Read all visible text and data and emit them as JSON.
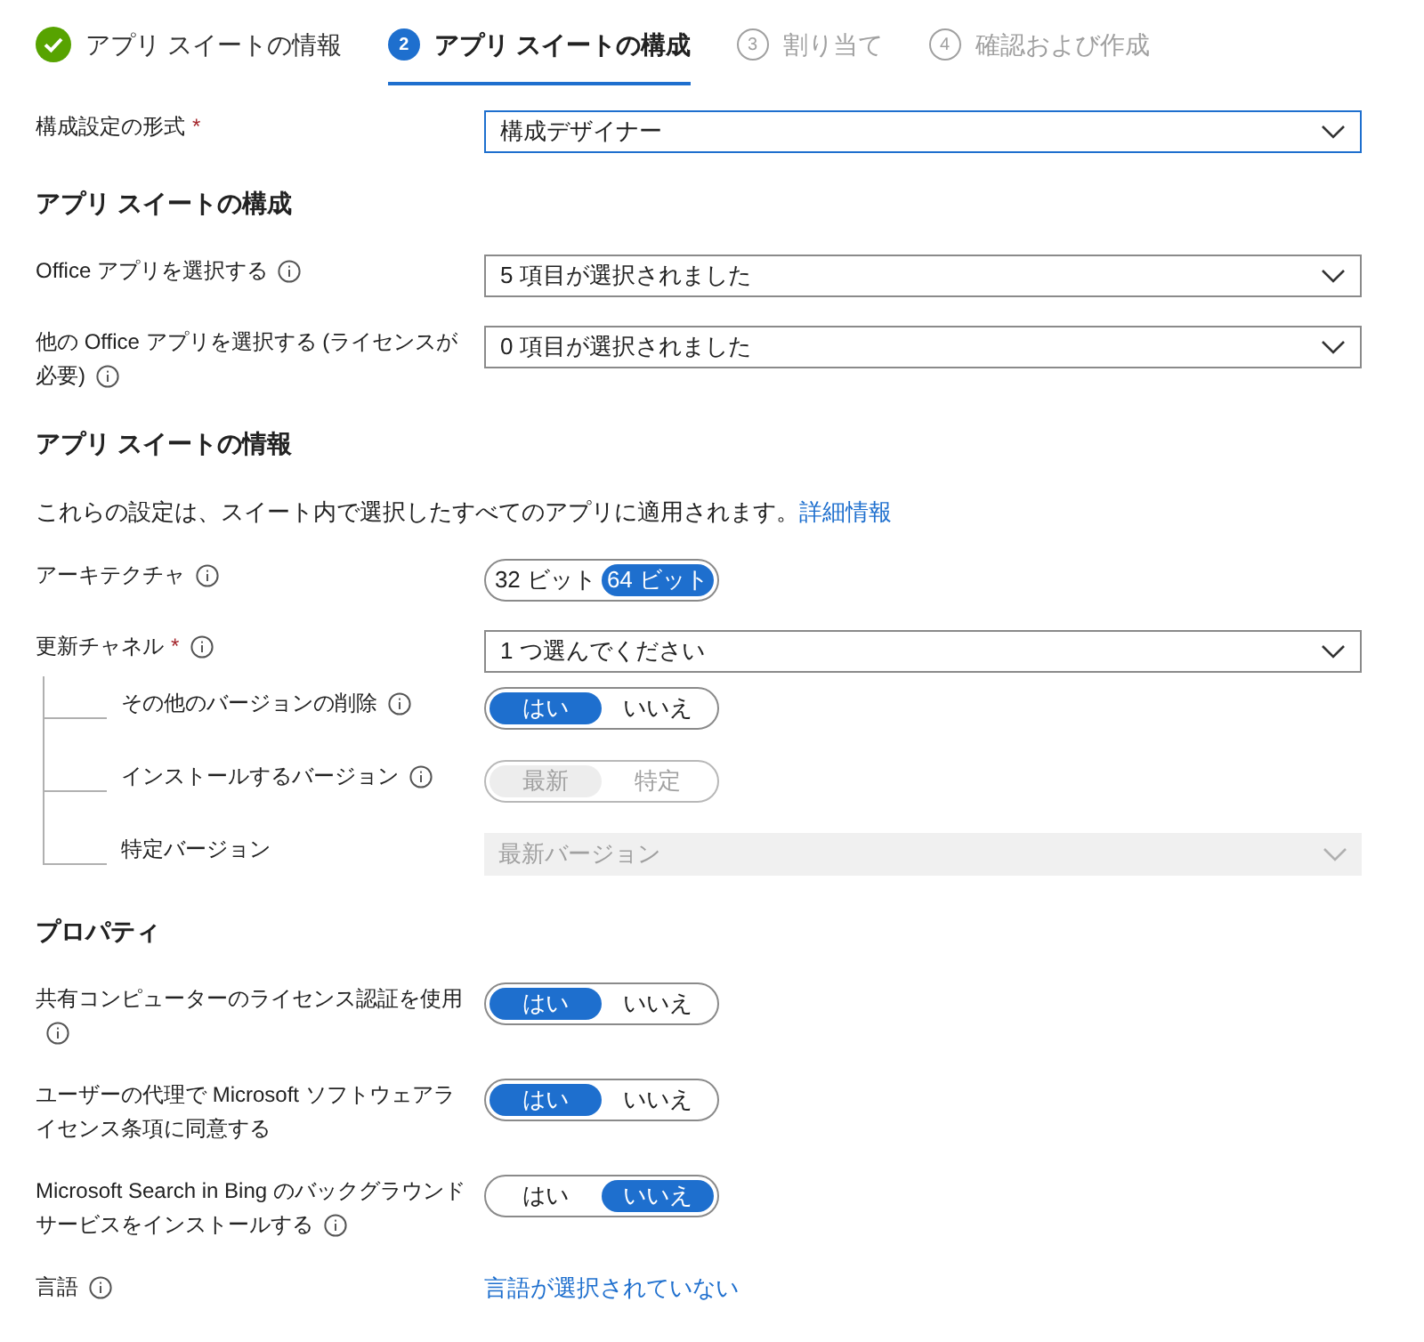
{
  "wizard_steps": [
    {
      "label": "アプリ スイートの情報",
      "completed": true,
      "selected": false
    },
    {
      "label": "アプリ スイートの構成",
      "number": "2",
      "completed": false,
      "selected": true
    },
    {
      "label": "割り当て",
      "number": "3",
      "completed": false,
      "selected": false
    },
    {
      "label": "確認および作成",
      "number": "4",
      "completed": false,
      "selected": false
    }
  ],
  "rows": [
    {
      "kind": "dropdown",
      "label": "構成設定の形式",
      "required_mark": "*",
      "info": false,
      "value": "構成デザイナー",
      "focused": true
    },
    {
      "kind": "heading",
      "label": "アプリ スイートの構成"
    },
    {
      "kind": "dropdown",
      "label": "Office アプリを選択する",
      "info": true,
      "value": "5 項目が選択されました",
      "focused": false
    },
    {
      "kind": "dropdown",
      "label": "他の Office アプリを選択する (ライセンスが必要)",
      "info": true,
      "value": "0 項目が選択されました",
      "focused": false
    },
    {
      "kind": "heading",
      "label": "アプリ スイートの情報"
    },
    {
      "kind": "description",
      "text": "これらの設定は、スイート内で選択したすべてのアプリに適用されます。",
      "link": "詳細情報"
    },
    {
      "kind": "toggle",
      "label": "アーキテクチャ",
      "info": true,
      "disabled": false,
      "options": [
        {
          "label": "32 ビット",
          "selected": false
        },
        {
          "label": "64 ビット",
          "selected": true
        }
      ]
    },
    {
      "kind": "dropdown",
      "label": "更新チャネル",
      "required_mark": "*",
      "info": true,
      "value": "1 つ選んでください",
      "focused": false,
      "children": [
        {
          "kind": "toggle",
          "label": "その他のバージョンの削除",
          "info": true,
          "disabled": false,
          "options": [
            {
              "label": "はい",
              "selected": true
            },
            {
              "label": "いいえ",
              "selected": false
            }
          ]
        },
        {
          "kind": "toggle",
          "label": "インストールするバージョン",
          "info": true,
          "disabled": true,
          "options": [
            {
              "label": "最新",
              "selected": true
            },
            {
              "label": "特定",
              "selected": false
            }
          ]
        },
        {
          "kind": "dropdown",
          "label": "特定バージョン",
          "info": false,
          "value": "最新バージョン",
          "disabled": true
        }
      ]
    },
    {
      "kind": "heading",
      "label": "プロパティ"
    },
    {
      "kind": "toggle",
      "label": "共有コンピューターのライセンス認証を使用",
      "info": true,
      "disabled": false,
      "options": [
        {
          "label": "はい",
          "selected": true
        },
        {
          "label": "いいえ",
          "selected": false
        }
      ]
    },
    {
      "kind": "toggle",
      "label": "ユーザーの代理で Microsoft ソフトウェアライセンス条項に同意する",
      "info": false,
      "disabled": false,
      "options": [
        {
          "label": "はい",
          "selected": true
        },
        {
          "label": "いいえ",
          "selected": false
        }
      ]
    },
    {
      "kind": "toggle",
      "label": "Microsoft Search in Bing のバックグラウンドサービスをインストールする",
      "info": true,
      "disabled": false,
      "options": [
        {
          "label": "はい",
          "selected": false
        },
        {
          "label": "いいえ",
          "selected": true
        }
      ]
    },
    {
      "kind": "link",
      "label": "言語",
      "info": true,
      "value": "言語が選択されていない"
    }
  ]
}
